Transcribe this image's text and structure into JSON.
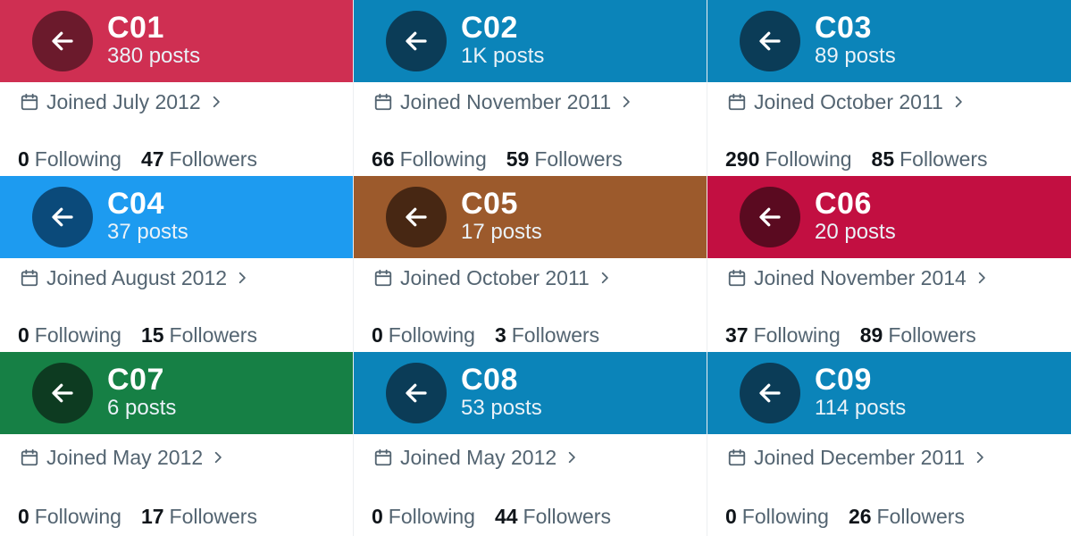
{
  "icons": {
    "back": "arrow-left-icon",
    "calendar": "calendar-icon",
    "chevron": "chevron-right-icon"
  },
  "cards": [
    {
      "name": "C01",
      "posts": "380 posts",
      "joined": "Joined July 2012",
      "following": "0",
      "followers": "47",
      "following_label": "Following",
      "followers_label": "Followers",
      "header_color": "#cf2f52",
      "button_color": "#6b1a2c"
    },
    {
      "name": "C02",
      "posts": "1K posts",
      "joined": "Joined November 2011",
      "following": "66",
      "followers": "59",
      "following_label": "Following",
      "followers_label": "Followers",
      "header_color": "#0b84b9",
      "button_color": "#0b3c57"
    },
    {
      "name": "C03",
      "posts": "89 posts",
      "joined": "Joined October 2011",
      "following": "290",
      "followers": "85",
      "following_label": "Following",
      "followers_label": "Followers",
      "header_color": "#0b84b9",
      "button_color": "#0b3c57"
    },
    {
      "name": "C04",
      "posts": "37 posts",
      "joined": "Joined August 2012",
      "following": "0",
      "followers": "15",
      "following_label": "Following",
      "followers_label": "Followers",
      "header_color": "#1d9bf0",
      "button_color": "#0b4a7a"
    },
    {
      "name": "C05",
      "posts": "17 posts",
      "joined": "Joined October 2011",
      "following": "0",
      "followers": "3",
      "following_label": "Following",
      "followers_label": "Followers",
      "header_color": "#9c5a2c",
      "button_color": "#472713"
    },
    {
      "name": "C06",
      "posts": "20 posts",
      "joined": "Joined November 2014",
      "following": "37",
      "followers": "89",
      "following_label": "Following",
      "followers_label": "Followers",
      "header_color": "#c20f41",
      "button_color": "#5a0a20"
    },
    {
      "name": "C07",
      "posts": "6 posts",
      "joined": "Joined May 2012",
      "following": "0",
      "followers": "17",
      "following_label": "Following",
      "followers_label": "Followers",
      "header_color": "#168045",
      "button_color": "#0d3b21"
    },
    {
      "name": "C08",
      "posts": "53 posts",
      "joined": "Joined May 2012",
      "following": "0",
      "followers": "44",
      "following_label": "Following",
      "followers_label": "Followers",
      "header_color": "#0b84b9",
      "button_color": "#0b3c57"
    },
    {
      "name": "C09",
      "posts": "114 posts",
      "joined": "Joined December 2011",
      "following": "0",
      "followers": "26",
      "following_label": "Following",
      "followers_label": "Followers",
      "header_color": "#0b84b9",
      "button_color": "#0b3c57"
    }
  ]
}
